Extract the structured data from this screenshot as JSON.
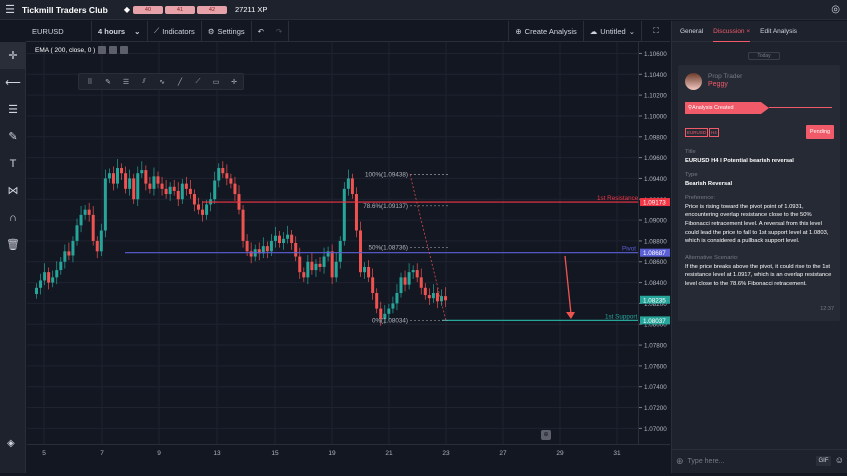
{
  "app": {
    "title": "Tickmill Traders Club",
    "badges": [
      "40",
      "41",
      "42"
    ],
    "xp": "27211 XP"
  },
  "toolbar": {
    "symbol": "EURUSD",
    "interval": "4 hours",
    "indicators": "Indicators",
    "settings": "Settings",
    "create_analysis": "Create Analysis",
    "layout_name": "Untitled"
  },
  "indicator": {
    "label": "EMA ( 200, close, 0 )"
  },
  "chart_data": {
    "type": "candlestick",
    "symbol": "EURUSD",
    "y_ticks": [
      "1.10600",
      "1.10400",
      "1.10200",
      "1.10000",
      "1.09800",
      "1.09600",
      "1.09400",
      "1.09200",
      "1.09000",
      "1.08800",
      "1.08600",
      "1.08400",
      "1.08200",
      "1.08000",
      "1.07800",
      "1.07600",
      "1.07400",
      "1.07200",
      "1.07000"
    ],
    "x_ticks": [
      "5",
      "7",
      "9",
      "13",
      "15",
      "19",
      "21",
      "23",
      "27",
      "29",
      "31"
    ],
    "ylim": [
      1.0685,
      1.1071
    ],
    "fib_levels": [
      {
        "label": "100%(1.09438)",
        "price": 1.09438
      },
      {
        "label": "78.6%(1.09137)",
        "price": 1.09137
      },
      {
        "label": "50%(1.08736)",
        "price": 1.08736
      },
      {
        "label": "0%(1.08034)",
        "price": 1.08034
      }
    ],
    "lines": [
      {
        "name": "1st Resistance",
        "price": 1.09173,
        "price_label": "1.09173",
        "color": "#f23645"
      },
      {
        "name": "Pivot",
        "price": 1.08687,
        "price_label": "1.08687",
        "color": "#5b5fd6"
      },
      {
        "name": "1st Support",
        "price": 1.08037,
        "price_label": "1.08037",
        "color": "#26a69a"
      }
    ],
    "last_price": {
      "price": 1.08235,
      "label": "1.08235",
      "color": "#26a69a"
    },
    "close_path": [
      1.0835,
      1.0842,
      1.085,
      1.084,
      1.0845,
      1.0852,
      1.086,
      1.087,
      1.0866,
      1.088,
      1.0895,
      1.0905,
      1.091,
      1.0905,
      1.088,
      1.087,
      1.089,
      1.094,
      1.0945,
      1.0935,
      1.095,
      1.0945,
      1.093,
      1.094,
      1.092,
      1.0945,
      1.0948,
      1.0935,
      1.093,
      1.0942,
      1.0935,
      1.093,
      1.0925,
      1.0932,
      1.0928,
      1.092,
      1.0935,
      1.093,
      1.0925,
      1.0915,
      1.091,
      1.0905,
      1.0915,
      1.092,
      1.0938,
      1.095,
      1.0945,
      1.094,
      1.0935,
      1.0925,
      1.091,
      1.088,
      1.087,
      1.0865,
      1.0872,
      1.0868,
      1.0875,
      1.087,
      1.088,
      1.0885,
      1.0878,
      1.0882,
      1.0886,
      1.0878,
      1.0865,
      1.085,
      1.0845,
      1.086,
      1.0852,
      1.0858,
      1.0855,
      1.0865,
      1.087,
      1.0845,
      1.086,
      1.088,
      1.093,
      1.094,
      1.0925,
      1.089,
      1.085,
      1.0855,
      1.0845,
      1.083,
      1.0815,
      1.0805,
      1.081,
      1.0815,
      1.082,
      1.083,
      1.0845,
      1.0838,
      1.085,
      1.0852,
      1.0845,
      1.0835,
      1.0828,
      1.0825,
      1.083,
      1.0822,
      1.0827,
      1.0823
    ]
  },
  "panel": {
    "tabs": [
      "General",
      "Discussion",
      "Edit Analysis"
    ],
    "today": "Today",
    "role": "Prop Trader",
    "name": "Peggy",
    "created": "Analysis Created",
    "tags": [
      "EURUSD",
      "H4"
    ],
    "status": "Pending",
    "title_label": "Title",
    "title_value": "EURUSD H4 I Potential bearish reversal",
    "type_label": "Type",
    "type_value": "Bearish Reversal",
    "pref_label": "Preference:",
    "pref_value": "Price is rising toward the pivot point of 1.0931, encountering overlap resistance close to the 50% Fibonacci retracement level. A reversal from this level could lead the price to fall to 1st support level at 1.0803, which is considered a pullback support level.",
    "alt_label": "Alternative Scenario:",
    "alt_value": "If the price breaks above the pivot, it could rise to the 1st resistance level at 1.0917, which is an overlap resistance level close to the 78.6% Fibonacci retracement.",
    "time": "12:37",
    "chat_placeholder": "Type here...",
    "gif": "GIF"
  }
}
